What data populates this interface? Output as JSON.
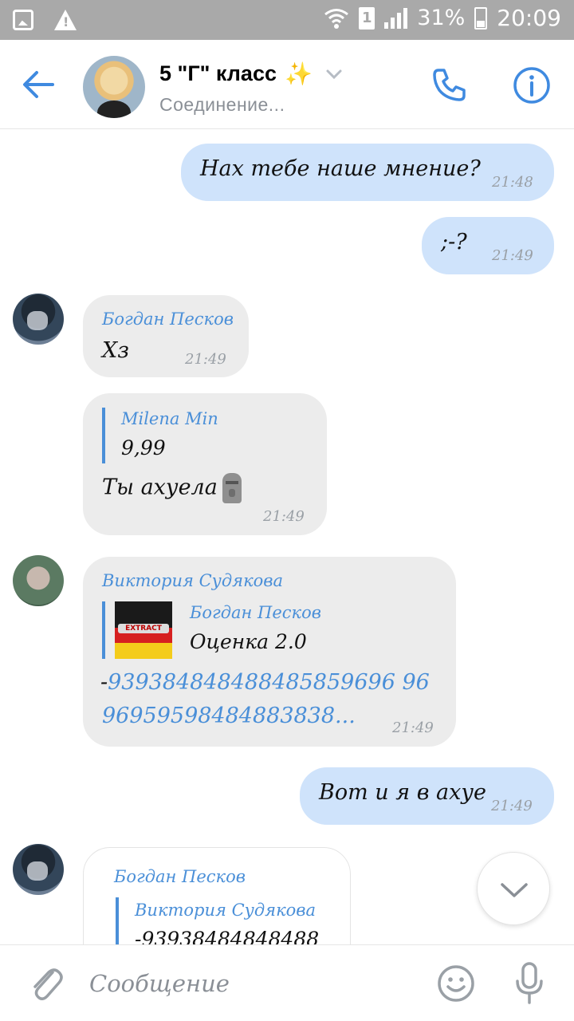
{
  "status_bar": {
    "sim_slot": "1",
    "battery": "31%",
    "time": "20:09"
  },
  "header": {
    "title": "5 \"Г\" класс",
    "title_emoji": "✨",
    "status": "Соединение..."
  },
  "messages": [
    {
      "type": "outgoing",
      "text": "Нах тебе наше мнение?",
      "time": "21:48"
    },
    {
      "type": "outgoing",
      "text": ";-?",
      "time": "21:49"
    },
    {
      "type": "incoming",
      "sender": "Богдан Песков",
      "text": "Хз",
      "time": "21:49"
    },
    {
      "type": "incoming",
      "quote_author": "Milena Min",
      "quote_text": "9,99",
      "text": "Ты ахуела",
      "emoji": "moai",
      "time": "21:49"
    },
    {
      "type": "incoming",
      "sender": "Виктория Судякова",
      "quote_author": "Богдан Песков",
      "quote_text": "Оценка 2.0",
      "text_prefix": "-",
      "text_number_line1": "939384848488485859696 96",
      "text_number_line2": "96959598484883838...",
      "time": "21:49"
    },
    {
      "type": "outgoing",
      "text": "Вот и я в ахуе",
      "time": "21:49"
    },
    {
      "type": "incoming",
      "sender": "Богдан Песков",
      "quote_author": "Виктория Судякова",
      "quote_text": "-93938484848488"
    }
  ],
  "composer": {
    "placeholder": "Сообщение"
  },
  "icons": [
    "image-icon",
    "warning-icon",
    "wifi-icon",
    "signal-icon",
    "battery-icon",
    "back-arrow-icon",
    "chevron-down-icon",
    "phone-icon",
    "info-icon",
    "attach-icon",
    "emoji-icon",
    "mic-icon"
  ],
  "colors": {
    "accent": "#4a8fd8",
    "outgoing_bubble": "#cfe3fb",
    "incoming_bubble": "#ececec",
    "status_bar": "#a9a9a9"
  }
}
